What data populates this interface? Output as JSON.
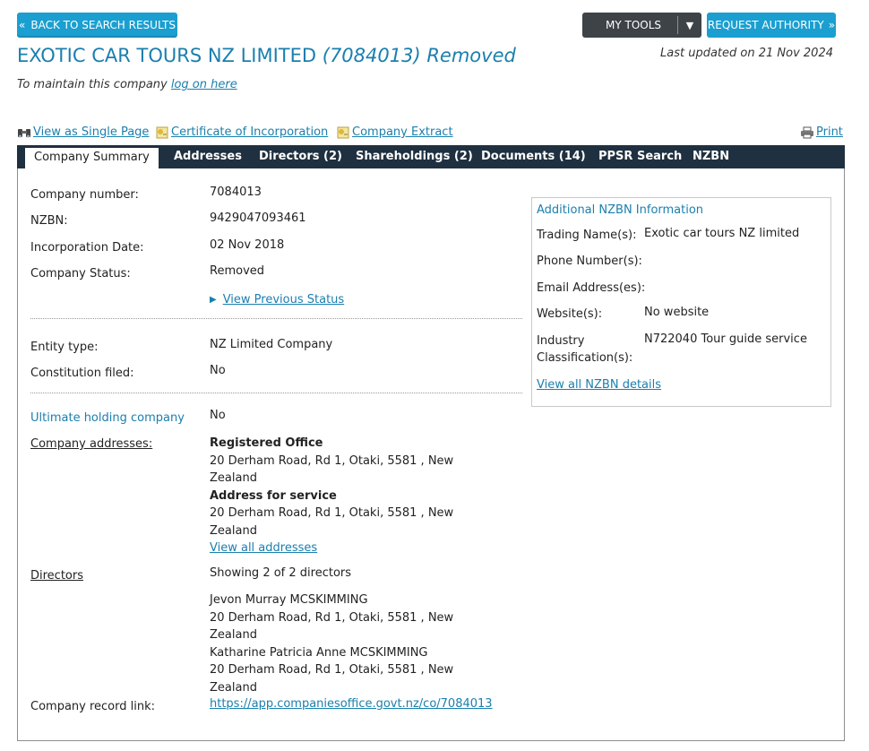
{
  "header": {
    "back_label": "BACK TO SEARCH RESULTS",
    "tools_label": "MY TOOLS",
    "request_label": "REQUEST AUTHORITY",
    "company_name": "EXOTIC CAR TOURS NZ LIMITED",
    "company_num_status": "(7084013) Removed",
    "last_updated": "Last updated on 21 Nov 2024",
    "maintain_text": "To maintain this company",
    "maintain_link": "log on here"
  },
  "toolbar": {
    "single_page": "View as Single Page",
    "certificate": "Certificate of Incorporation",
    "extract": "Company Extract",
    "print": "Print"
  },
  "tabs": [
    {
      "label": "Company Summary"
    },
    {
      "label": "Addresses"
    },
    {
      "label": "Directors (2)"
    },
    {
      "label": "Shareholdings (2)"
    },
    {
      "label": "Documents (14)"
    },
    {
      "label": "PPSR Search"
    },
    {
      "label": "NZBN"
    }
  ],
  "summary": {
    "company_number_label": "Company number:",
    "company_number": "7084013",
    "nzbn_label": "NZBN:",
    "nzbn": "9429047093461",
    "incorp_label": "Incorporation Date:",
    "incorp_date": "02 Nov 2018",
    "status_label": "Company Status:",
    "status": "Removed",
    "view_prev_status": "View Previous Status",
    "entity_label": "Entity type:",
    "entity": "NZ Limited Company",
    "constitution_label": "Constitution filed:",
    "constitution": "No",
    "ultimate_label": "Ultimate holding company",
    "ultimate": "No",
    "addresses_label": "Company addresses:",
    "reg_office_label": "Registered Office",
    "reg_office_line1": "20 Derham Road, Rd 1, Otaki, 5581 , New",
    "reg_office_line2": "Zealand",
    "service_label": "Address for service",
    "service_line1": "20 Derham Road, Rd 1, Otaki, 5581 , New",
    "service_line2": "Zealand",
    "view_all_addresses": "View all addresses",
    "directors_label": "Directors",
    "directors_showing": "Showing 2 of 2 directors",
    "directors": [
      {
        "name": "Jevon Murray MCSKIMMING",
        "addr1": "20 Derham Road, Rd 1, Otaki, 5581 , New",
        "addr2": "Zealand"
      },
      {
        "name": "Katharine Patricia Anne MCSKIMMING",
        "addr1": "20 Derham Road, Rd 1, Otaki, 5581 , New",
        "addr2": "Zealand"
      }
    ],
    "record_link_label": "Company record link:",
    "record_link": "https://app.companiesoffice.govt.nz/co/7084013"
  },
  "nzbn_info": {
    "title": "Additional NZBN Information",
    "trading_label": "Trading Name(s):",
    "trading": "Exotic car tours NZ limited",
    "phone_label": "Phone Number(s):",
    "email_label": "Email Address(es):",
    "website_label": "Website(s):",
    "website": "No website",
    "industry_label_1": "Industry",
    "industry_label_2": "Classification(s):",
    "industry": "N722040 Tour guide service",
    "view_all": "View all NZBN details"
  },
  "colors": {
    "accent": "#1a9fd0",
    "link": "#1a7fae",
    "tabbar": "#1f3040",
    "tools_button": "#3d4347"
  }
}
